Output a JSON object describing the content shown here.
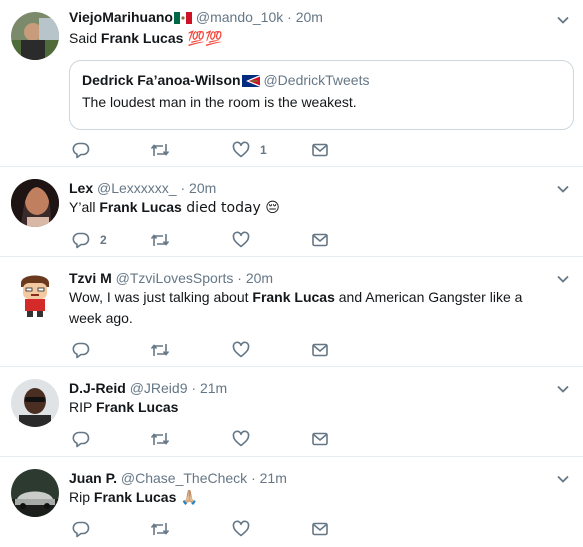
{
  "colors": {
    "secondary_text": "#657786",
    "border": "#e6ecf0"
  },
  "tweets": [
    {
      "name": "ViejoMarihuano",
      "handle": "@mando_10k",
      "separator": "·",
      "time": "20m",
      "text_prefix": "Said ",
      "text_bold": "Frank Lucas",
      "text_suffix": " 💯💯",
      "quote": {
        "name": "Dedrick Fa’anoa-Wilson",
        "handle": "@DedrickTweets",
        "text": "The loudest man in the room is the weakest."
      },
      "like_count": "1"
    },
    {
      "name": "Lex",
      "handle": "@Lexxxxxx_",
      "separator": "·",
      "time": "20m",
      "text_prefix": "Y’all ",
      "text_bold": "Frank Lucas",
      "text_suffix": " died today 😔",
      "reply_count": "2"
    },
    {
      "name": "Tzvi M",
      "handle": "@TzviLovesSports",
      "separator": "·",
      "time": "20m",
      "text_prefix": "Wow, I was just talking about ",
      "text_bold": "Frank Lucas",
      "text_suffix": " and American Gangster like a week ago."
    },
    {
      "name": "D.J-Reid",
      "handle": "@JReid9",
      "separator": "·",
      "time": "21m",
      "text_prefix": "RIP ",
      "text_bold": "Frank Lucas",
      "text_suffix": ""
    },
    {
      "name": "Juan P.",
      "handle": "@Chase_TheCheck",
      "separator": "·",
      "time": "21m",
      "text_prefix": "Rip ",
      "text_bold": "Frank Lucas",
      "text_suffix": " 🙏🏼"
    }
  ]
}
